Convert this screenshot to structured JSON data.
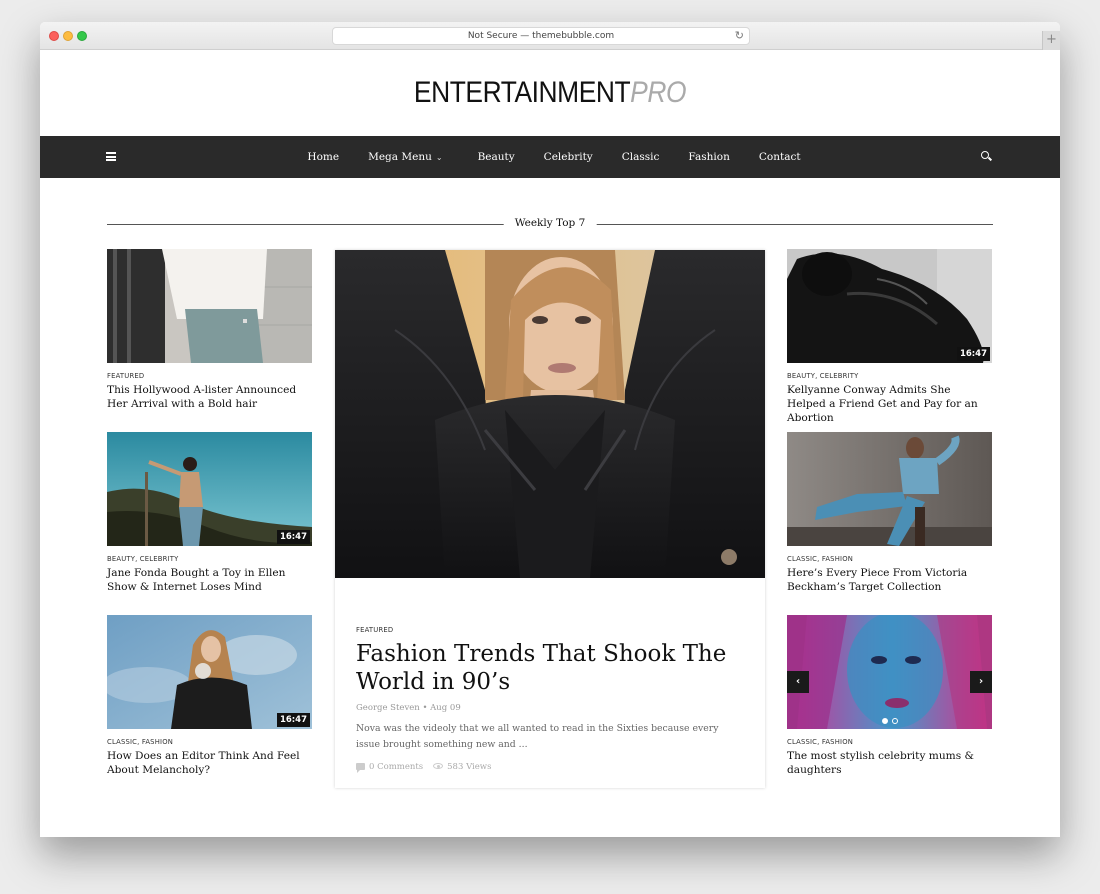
{
  "browser": {
    "address": "Not Secure — themebubble.com",
    "reload_icon": "reload-icon",
    "newtab_icon": "plus-icon",
    "newtab_glyph": "+"
  },
  "site": {
    "logo_main": "ENTERTAINMENT",
    "logo_accent": "PRO"
  },
  "nav": {
    "items": [
      "Home",
      "Mega Menu",
      "Beauty",
      "Celebrity",
      "Classic",
      "Fashion",
      "Contact"
    ],
    "mega_chevron": "⌄"
  },
  "section": {
    "title": "Weekly Top 7"
  },
  "left_posts": [
    {
      "category": "FEATURED",
      "title": "This Hollywood A-lister Announced Her Arrival with a Bold hair"
    },
    {
      "category": "BEAUTY, CELEBRITY",
      "title": "Jane Fonda Bought a Toy in Ellen Show & Internet Loses Mind",
      "duration": "16:47"
    },
    {
      "category": "CLASSIC, FASHION",
      "title": "How Does an Editor Think And Feel About Melancholy?",
      "duration": "16:47"
    }
  ],
  "right_posts": [
    {
      "category": "BEAUTY, CELEBRITY",
      "title": "Kellyanne Conway Admits She Helped a Friend Get and Pay for an Abortion",
      "duration": "16:47"
    },
    {
      "category": "CLASSIC, FASHION",
      "title": "Here’s Every Piece From Victoria Beckham’s Target Collection"
    },
    {
      "category": "CLASSIC, FASHION",
      "title": "The most stylish celebrity mums & daughters",
      "slider_prev": "‹",
      "slider_next": "›"
    }
  ],
  "feature": {
    "category": "FEATURED",
    "title": "Fashion Trends That Shook The World in 90’s",
    "meta": "George Steven • Aug 09",
    "excerpt": "Nova was the videoly that we all wanted to read in the Sixties because every issue brought something new and ...",
    "comments": "0 Comments",
    "views": "583 Views"
  },
  "colors": {
    "nav_bg": "#2a2a2a",
    "logo_accent": "#aaaaaa"
  }
}
